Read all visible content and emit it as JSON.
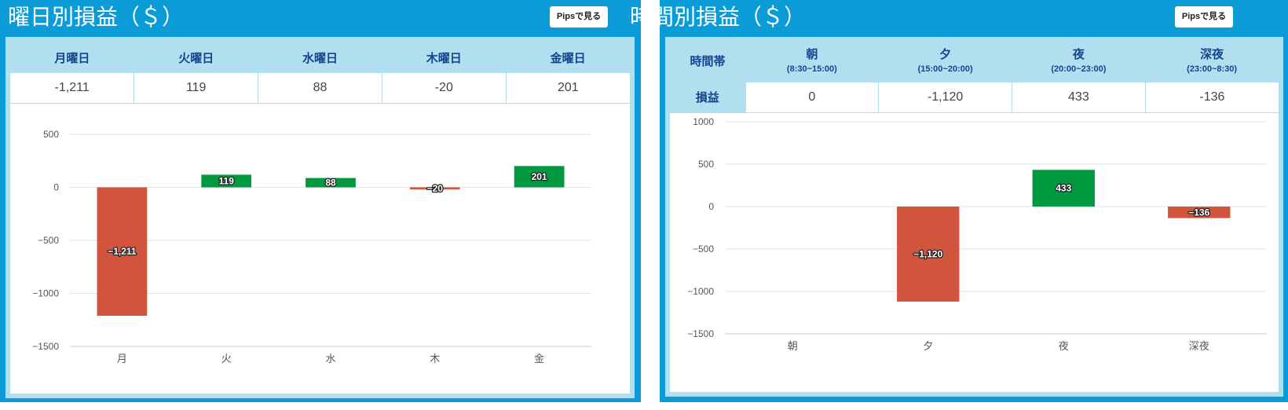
{
  "left": {
    "title": "曜日別損益（＄）",
    "pips_button": "Pipsで見る",
    "headers": [
      "月曜日",
      "火曜日",
      "水曜日",
      "木曜日",
      "金曜日"
    ],
    "values": [
      "-1,211",
      "119",
      "88",
      "-20",
      "201"
    ]
  },
  "right": {
    "title": "時間別損益（＄）",
    "pips_button": "Pipsで見る",
    "row_header_label": "時間帯",
    "row_value_label": "損益",
    "headers": [
      {
        "name": "朝",
        "range": "(8:30~15:00)"
      },
      {
        "name": "夕",
        "range": "(15:00~20:00)"
      },
      {
        "name": "夜",
        "range": "(20:00~23:00)"
      },
      {
        "name": "深夜",
        "range": "(23:00~8:30)"
      }
    ],
    "values": [
      "0",
      "-1,120",
      "433",
      "-136"
    ]
  },
  "colors": {
    "positive": "#00993f",
    "negative": "#d0553c",
    "panel": "#0b9bd6",
    "header": "#b2dff0"
  },
  "chart_data": [
    {
      "type": "bar",
      "categories": [
        "月",
        "火",
        "水",
        "木",
        "金"
      ],
      "values": [
        -1211,
        119,
        88,
        -20,
        201
      ],
      "data_labels": [
        "-1,211",
        "119",
        "88",
        "-20",
        "201"
      ],
      "yticks": [
        500,
        0,
        -500,
        -1000,
        -1500
      ],
      "ylim": [
        -1500,
        500
      ],
      "grid": true
    },
    {
      "type": "bar",
      "categories": [
        "朝",
        "夕",
        "夜",
        "深夜"
      ],
      "values": [
        0,
        -1120,
        433,
        -136
      ],
      "data_labels": [
        "",
        "-1,120",
        "433",
        "-136"
      ],
      "yticks": [
        1000,
        500,
        0,
        -500,
        -1000,
        -1500
      ],
      "ylim": [
        -1500,
        1000
      ],
      "grid": true
    }
  ]
}
